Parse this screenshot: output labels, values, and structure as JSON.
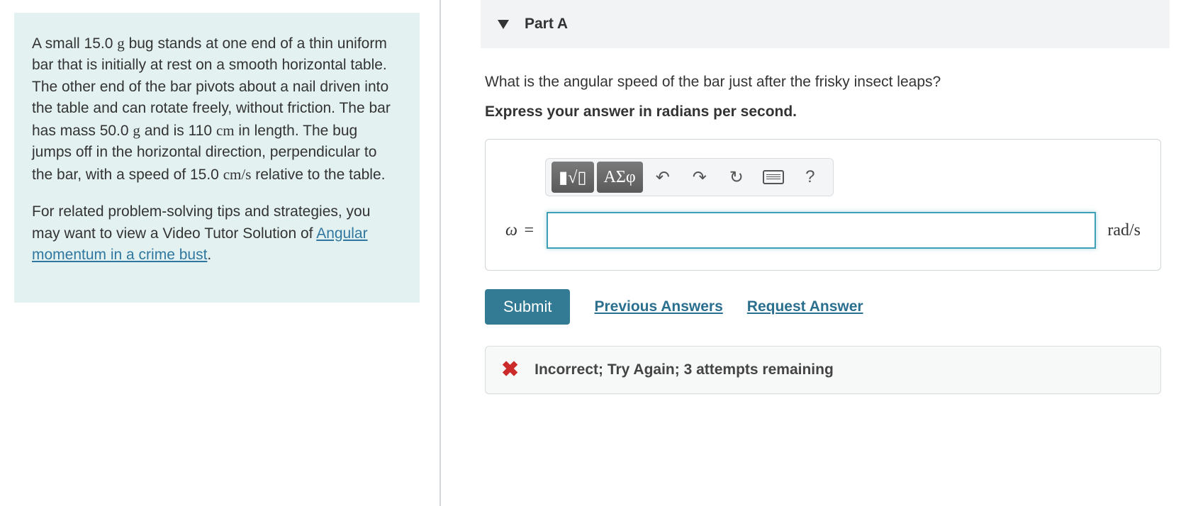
{
  "problem": {
    "para1_a": "A small 15.0 ",
    "u1": "g",
    "para1_b": " bug stands at one end of a thin uniform bar that is initially at rest on a smooth horizontal table. The other end of the bar pivots about a nail driven into the table and can rotate freely, without friction. The bar has mass 50.0 ",
    "u2": "g",
    "para1_c": " and is 110 ",
    "u3": "cm",
    "para1_d": " in length. The bug jumps off in the horizontal direction, perpendicular to the bar, with a speed of 15.0 ",
    "u4": "cm/s",
    "para1_e": " relative to the table.",
    "para2_a": "For related problem-solving tips and strategies, you may want to view a Video Tutor Solution of ",
    "link_text": "Angular momentum in a crime bust",
    "para2_b": "."
  },
  "part": {
    "title": "Part A",
    "question": "What is the angular speed of the bar just after the frisky insect leaps?",
    "instruction": "Express your answer in radians per second.",
    "omega_label": "ω =",
    "unit_label": "rad/s",
    "input_value": ""
  },
  "toolbar": {
    "tmpl": "▮√▯",
    "greek": "ΑΣφ",
    "undo": "↶",
    "redo": "↷",
    "reset": "↻",
    "help": "?"
  },
  "actions": {
    "submit": "Submit",
    "previous": "Previous Answers",
    "request": "Request Answer"
  },
  "feedback": {
    "text": "Incorrect; Try Again; 3 attempts remaining"
  }
}
